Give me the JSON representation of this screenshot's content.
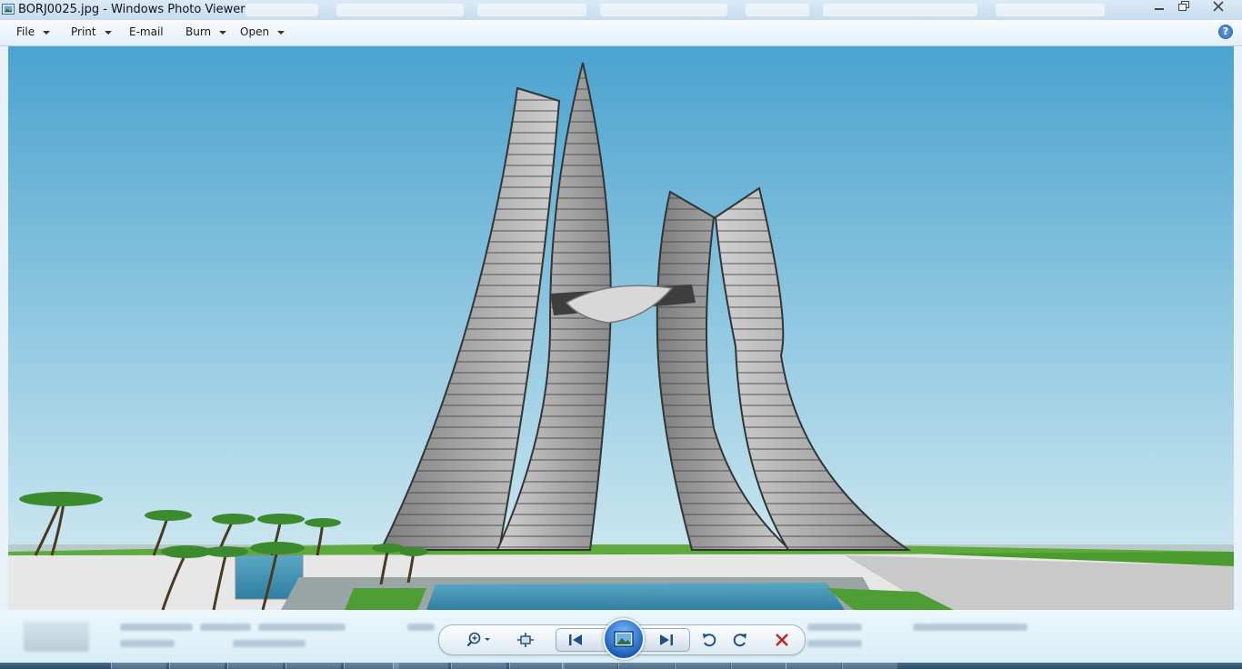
{
  "window": {
    "title": "BORJ0025.jpg - Windows Photo Viewer"
  },
  "menu": {
    "file": "File",
    "print": "Print",
    "email": "E-mail",
    "burn": "Burn",
    "open": "Open",
    "help_symbol": "?"
  },
  "photo": {
    "description_icon": "image-icon"
  },
  "controls": {
    "zoom_icon": "zoom-icon",
    "fit_icon": "actual-size-icon",
    "previous_icon": "previous-icon",
    "slideshow_icon": "slideshow-icon",
    "next_icon": "next-icon",
    "rotate_left_icon": "rotate-counterclockwise-icon",
    "rotate_right_icon": "rotate-clockwise-icon",
    "delete_icon": "delete-icon"
  },
  "colors": {
    "sky_top": "#4aa3cf",
    "sky_bottom": "#d9eef3",
    "delete_red": "#c0241c",
    "accent_blue": "#1d5fb8"
  }
}
